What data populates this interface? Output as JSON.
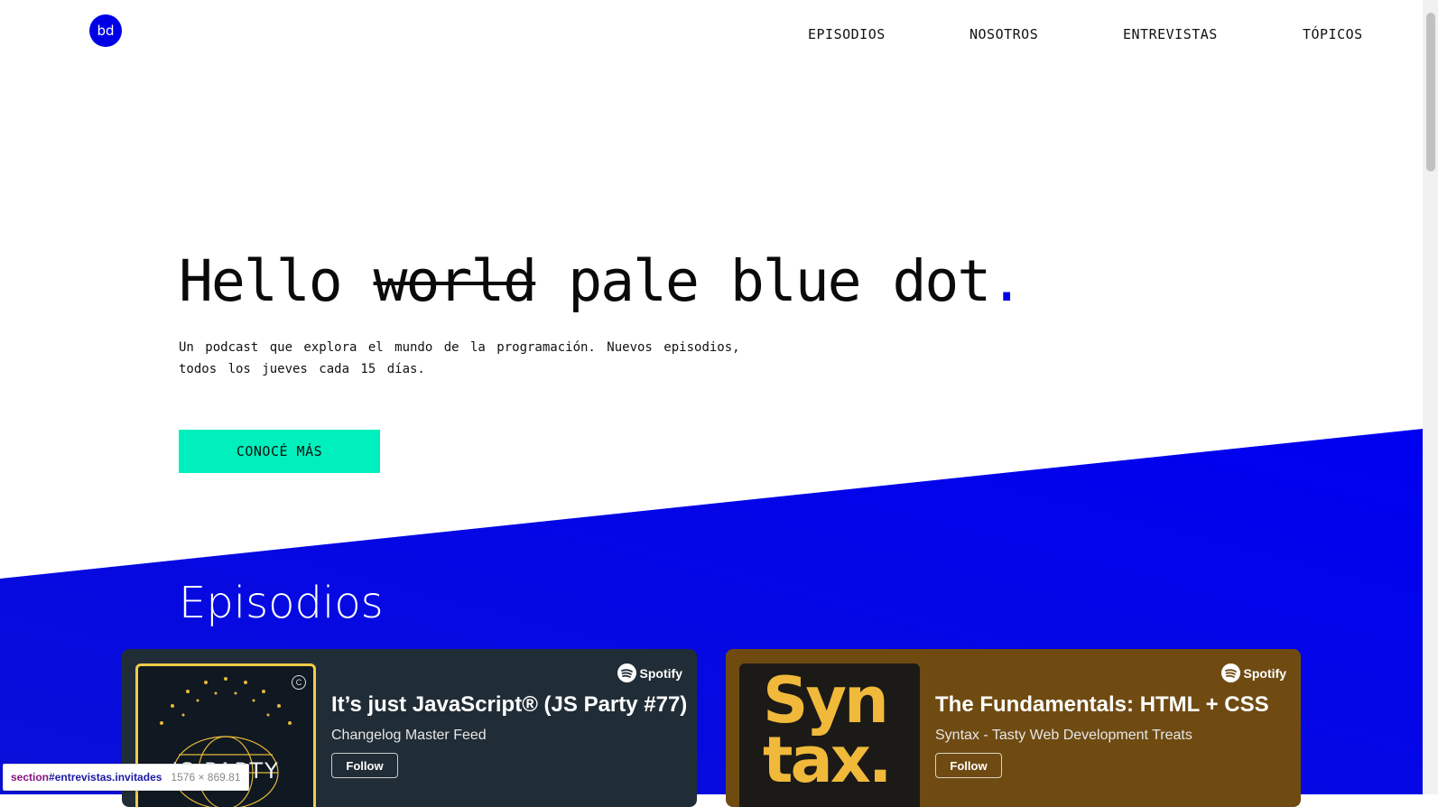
{
  "brand": {
    "logo_text": "bd",
    "accent_color": "#0000e6"
  },
  "nav": [
    "EPISODIOS",
    "NOSOTROS",
    "ENTREVISTAS",
    "TÓPICOS"
  ],
  "hero": {
    "word1": "Hello",
    "struck_word": "world",
    "title_rest": "pale blue dot",
    "title_dot": ".",
    "subtitle": "Un podcast que explora el mundo de la programación. Nuevos episodios, todos los jueves cada 15 días.",
    "cta": "CONOCÉ MÁS",
    "cta_color": "#00f0bd"
  },
  "episodes": {
    "section_title": "Episodios",
    "cards": [
      {
        "title": "It’s just JavaScript® (JS Party #77)",
        "show": "Changelog Master Feed",
        "follow": "Follow",
        "provider": "Spotify",
        "cover_text": "JS PARTY",
        "cover_badge": "C",
        "background": "#212d36"
      },
      {
        "title": "The Fundamentals: HTML + CSS",
        "show": "Syntax - Tasty Web Development Treats",
        "follow": "Follow",
        "provider": "Spotify",
        "cover_text": "Syn tax.",
        "background": "#6f4b12"
      }
    ]
  },
  "devtools_tooltip": {
    "tag": "section",
    "selector": "#entrevistas.invitades",
    "size": "1576 × 869.81"
  }
}
